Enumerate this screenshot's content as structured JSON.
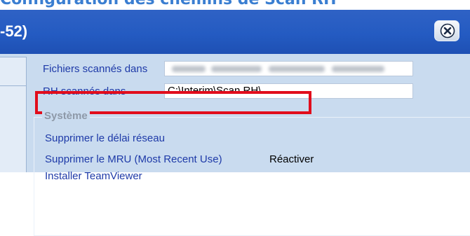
{
  "window": {
    "title_fragment": "-52)",
    "top_fragment": "Configuration des chemins de Scan RH"
  },
  "icons": {
    "close": "close-icon"
  },
  "colors": {
    "titlebar": "#245bc2",
    "highlight": "#e10d1c",
    "label_text": "#1e3aa8",
    "panel_bg": "#c9dbef"
  },
  "paths": {
    "fichiers_label": "Fichiers scannés dans",
    "fichiers_value": "",
    "rh_label": "RH scannés dans",
    "rh_value": "C:\\Interim\\Scan RH\\"
  },
  "systeme": {
    "title": "Système",
    "items": [
      {
        "label": "Supprimer le délai réseau"
      },
      {
        "label": "Supprimer le MRU (Most Recent Use)",
        "action": "Réactiver"
      },
      {
        "label": "Installer TeamViewer"
      }
    ]
  }
}
